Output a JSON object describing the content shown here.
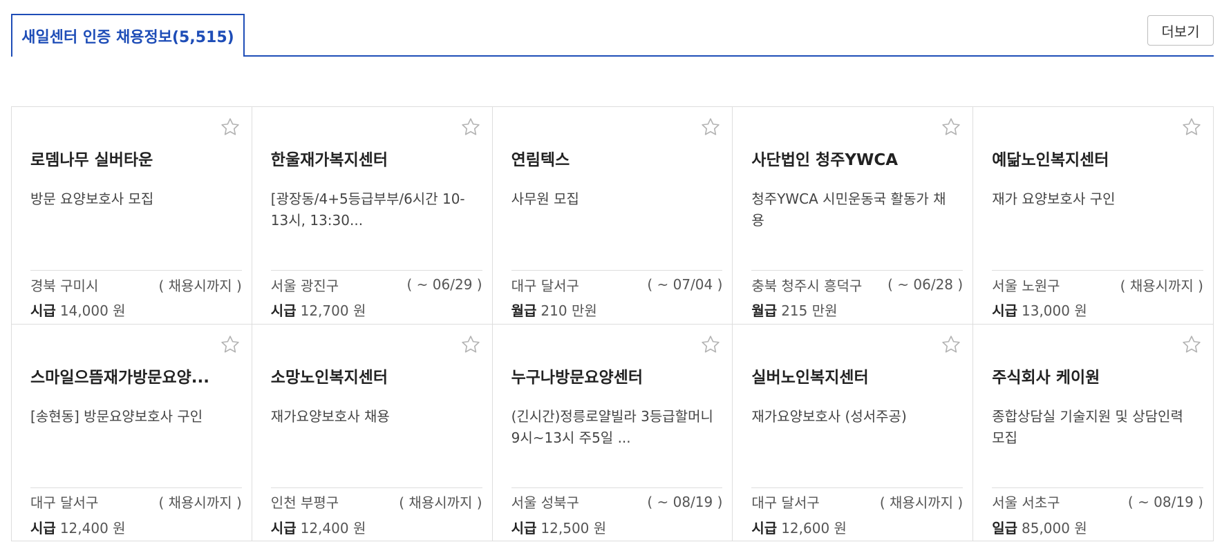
{
  "tab": {
    "label": "새일센터 인증 채용정보(5,515)"
  },
  "more_label": "더보기",
  "colors": {
    "accent": "#1e4db7",
    "border": "#dddddd"
  },
  "icons": {
    "favorite": "star-outline-icon"
  },
  "jobs": [
    {
      "company": "로뎀나무 실버타운",
      "title": "방문 요양보호사 모집",
      "location": "경북 구미시",
      "deadline": "( 채용시까지 )",
      "pay_type": "시급",
      "pay_amount": "14,000 원"
    },
    {
      "company": "한울재가복지센터",
      "title": "[광장동/4+5등급부부/6시간 10-13시, 13:30...",
      "location": "서울 광진구",
      "deadline": "( ~ 06/29 )",
      "pay_type": "시급",
      "pay_amount": "12,700 원"
    },
    {
      "company": "연림텍스",
      "title": "사무원 모집",
      "location": "대구 달서구",
      "deadline": "( ~ 07/04 )",
      "pay_type": "월급",
      "pay_amount": "210 만원"
    },
    {
      "company": "사단법인 청주YWCA",
      "title": "청주YWCA 시민운동국 활동가 채용",
      "location": "충북 청주시 흥덕구",
      "deadline": "( ~ 06/28 )",
      "pay_type": "월급",
      "pay_amount": "215 만원"
    },
    {
      "company": "예닮노인복지센터",
      "title": "재가 요양보호사 구인",
      "location": "서울 노원구",
      "deadline": "( 채용시까지 )",
      "pay_type": "시급",
      "pay_amount": "13,000 원"
    },
    {
      "company": "스마일으뜸재가방문요양...",
      "title": "[송현동] 방문요양보호사 구인",
      "location": "대구 달서구",
      "deadline": "( 채용시까지 )",
      "pay_type": "시급",
      "pay_amount": "12,400 원"
    },
    {
      "company": "소망노인복지센터",
      "title": "재가요양보호사 채용",
      "location": "인천 부평구",
      "deadline": "( 채용시까지 )",
      "pay_type": "시급",
      "pay_amount": "12,400 원"
    },
    {
      "company": "누구나방문요양센터",
      "title": "(긴시간)정릉로얄빌라 3등급할머니 9시~13시 주5일 ...",
      "location": "서울 성북구",
      "deadline": "( ~ 08/19 )",
      "pay_type": "시급",
      "pay_amount": "12,500 원"
    },
    {
      "company": "실버노인복지센터",
      "title": "재가요양보호사 (성서주공)",
      "location": "대구 달서구",
      "deadline": "( 채용시까지 )",
      "pay_type": "시급",
      "pay_amount": "12,600 원"
    },
    {
      "company": "주식회사 케이원",
      "title": "종합상담실 기술지원 및 상담인력 모집",
      "location": "서울 서초구",
      "deadline": "( ~ 08/19 )",
      "pay_type": "일급",
      "pay_amount": "85,000 원"
    }
  ]
}
